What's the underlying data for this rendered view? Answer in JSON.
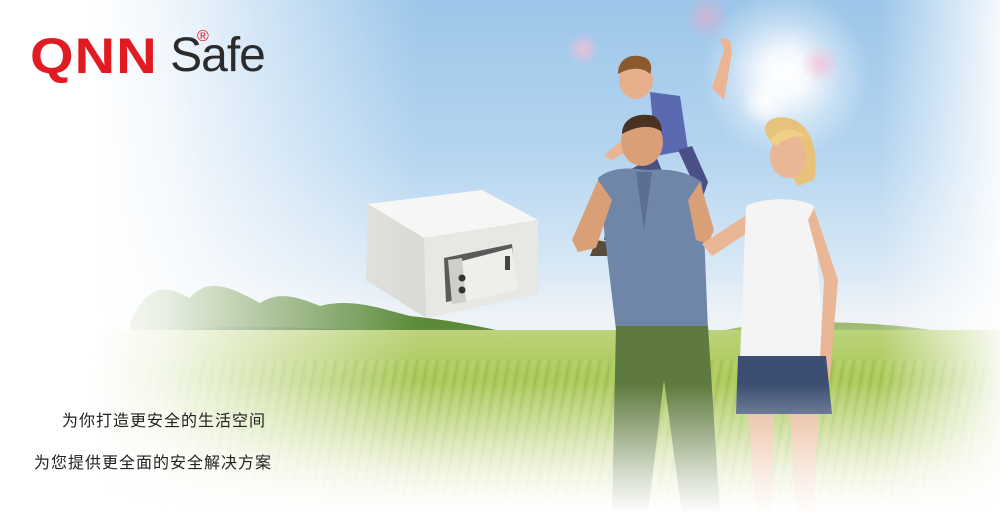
{
  "logo": {
    "brand_red": "QNN",
    "registered_mark": "®",
    "brand_dark": "Safe",
    "colors": {
      "red": "#e11b22",
      "dark": "#2b2b2b"
    }
  },
  "slogans": [
    "为你打造更安全的生活空间",
    "为您提供更全面的安全解决方案"
  ],
  "scene": {
    "sky_color": "#9cc6ea",
    "grass_color": "#a9c85a"
  }
}
